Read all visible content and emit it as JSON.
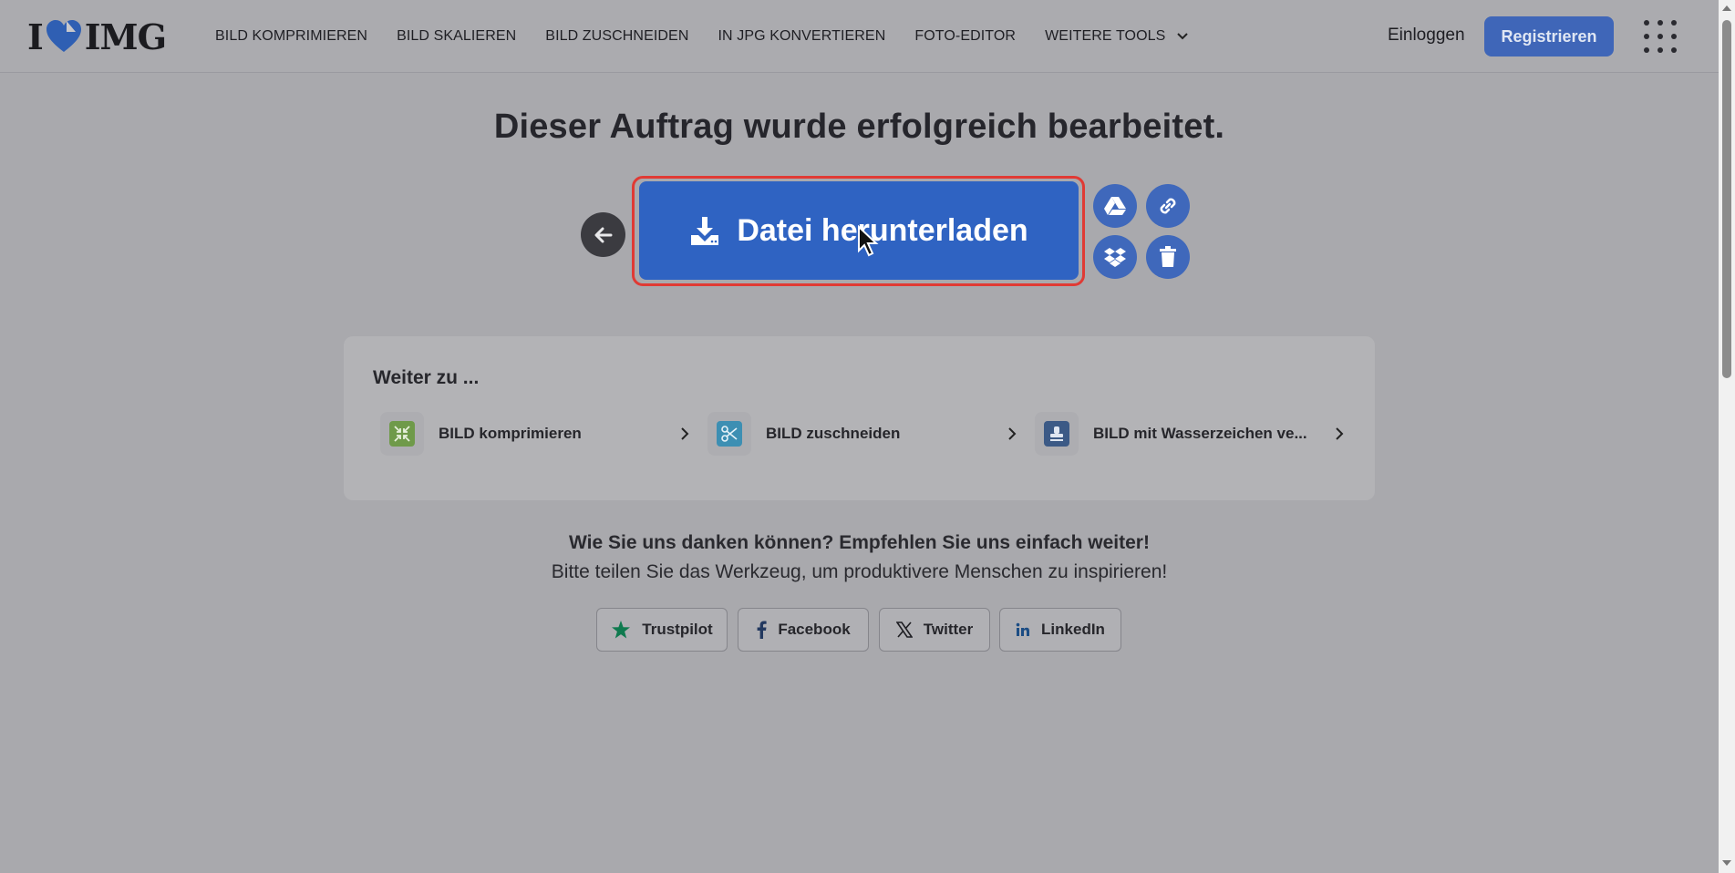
{
  "header": {
    "logo_left": "I",
    "logo_right": "IMG",
    "nav": [
      {
        "label": "BILD KOMPRIMIEREN"
      },
      {
        "label": "BILD SKALIEREN"
      },
      {
        "label": "BILD ZUSCHNEIDEN"
      },
      {
        "label": "IN JPG KONVERTIEREN"
      },
      {
        "label": "FOTO-EDITOR"
      },
      {
        "label": "WEITERE TOOLS"
      }
    ],
    "login_label": "Einloggen",
    "register_label": "Registrieren"
  },
  "main": {
    "headline": "Dieser Auftrag wurde erfolgreich bearbeitet.",
    "download_label": "Datei herunterladen",
    "side_buttons": [
      "google-drive-icon",
      "link-icon",
      "dropbox-icon",
      "trash-icon"
    ]
  },
  "continue": {
    "title": "Weiter zu ...",
    "tools": [
      {
        "label": "BILD komprimieren",
        "icon": "compress-icon",
        "color": "#6f9a4a"
      },
      {
        "label": "BILD zuschneiden",
        "icon": "scissors-icon",
        "color": "#3d8fb3"
      },
      {
        "label": "BILD mit Wasserzeichen ve...",
        "icon": "stamp-icon",
        "color": "#3c5a86"
      }
    ]
  },
  "share": {
    "line1": "Wie Sie uns danken können? Empfehlen Sie uns einfach weiter!",
    "line2": "Bitte teilen Sie das Werkzeug, um produktivere Menschen zu inspirieren!",
    "buttons": [
      {
        "label": "Trustpilot",
        "icon": "star-icon",
        "color": "#0f7a4f"
      },
      {
        "label": "Facebook",
        "icon": "facebook-icon"
      },
      {
        "label": "Twitter",
        "icon": "x-icon"
      },
      {
        "label": "LinkedIn",
        "icon": "linkedin-icon",
        "color": "#1c4d84"
      }
    ]
  },
  "colors": {
    "accent": "#2f63c2",
    "highlight": "#e03a34"
  }
}
